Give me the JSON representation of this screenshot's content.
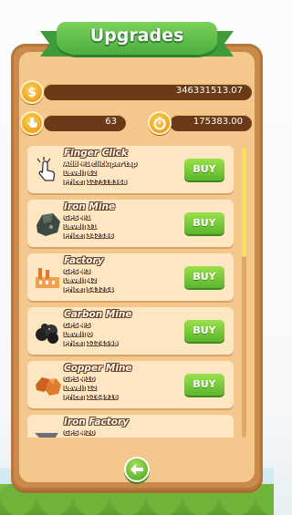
{
  "title": "Upgrades",
  "stats": {
    "coins": "346331513.07",
    "clicks": "63",
    "timer_value": "175383.00"
  },
  "items": [
    {
      "name": "Finger Click",
      "line1": "Add +1 click per tap",
      "level": "Level: 62",
      "price": "Price: 127518368",
      "buy": "BUY",
      "icon": "finger-icon"
    },
    {
      "name": "Iron Mine",
      "line1": "GPS +1",
      "level": "Level: 31",
      "price": "Price: 342586",
      "buy": "BUY",
      "icon": "iron-ore-icon"
    },
    {
      "name": "Factory",
      "line1": "GPS +3",
      "level": "Level: 42",
      "price": "Price: 543254",
      "buy": "BUY",
      "icon": "factory-icon"
    },
    {
      "name": "Carbon Mine",
      "line1": "GPS +5",
      "level": "Level: 0",
      "price": "Price: 1124598",
      "buy": "BUY",
      "icon": "coal-icon"
    },
    {
      "name": "Copper Mine",
      "line1": "GPS +10",
      "level": "Level: 12",
      "price": "Price: 1164916",
      "buy": "BUY",
      "icon": "copper-ore-icon"
    },
    {
      "name": "Iron Factory",
      "line1": "GPS +20",
      "level": "",
      "price": "",
      "buy": "",
      "icon": "anvil-icon"
    }
  ],
  "colors": {
    "panel": "#c98a4b",
    "card": "#fde7c3",
    "buy": "#5cb52c",
    "banner": "#4caf3f"
  }
}
